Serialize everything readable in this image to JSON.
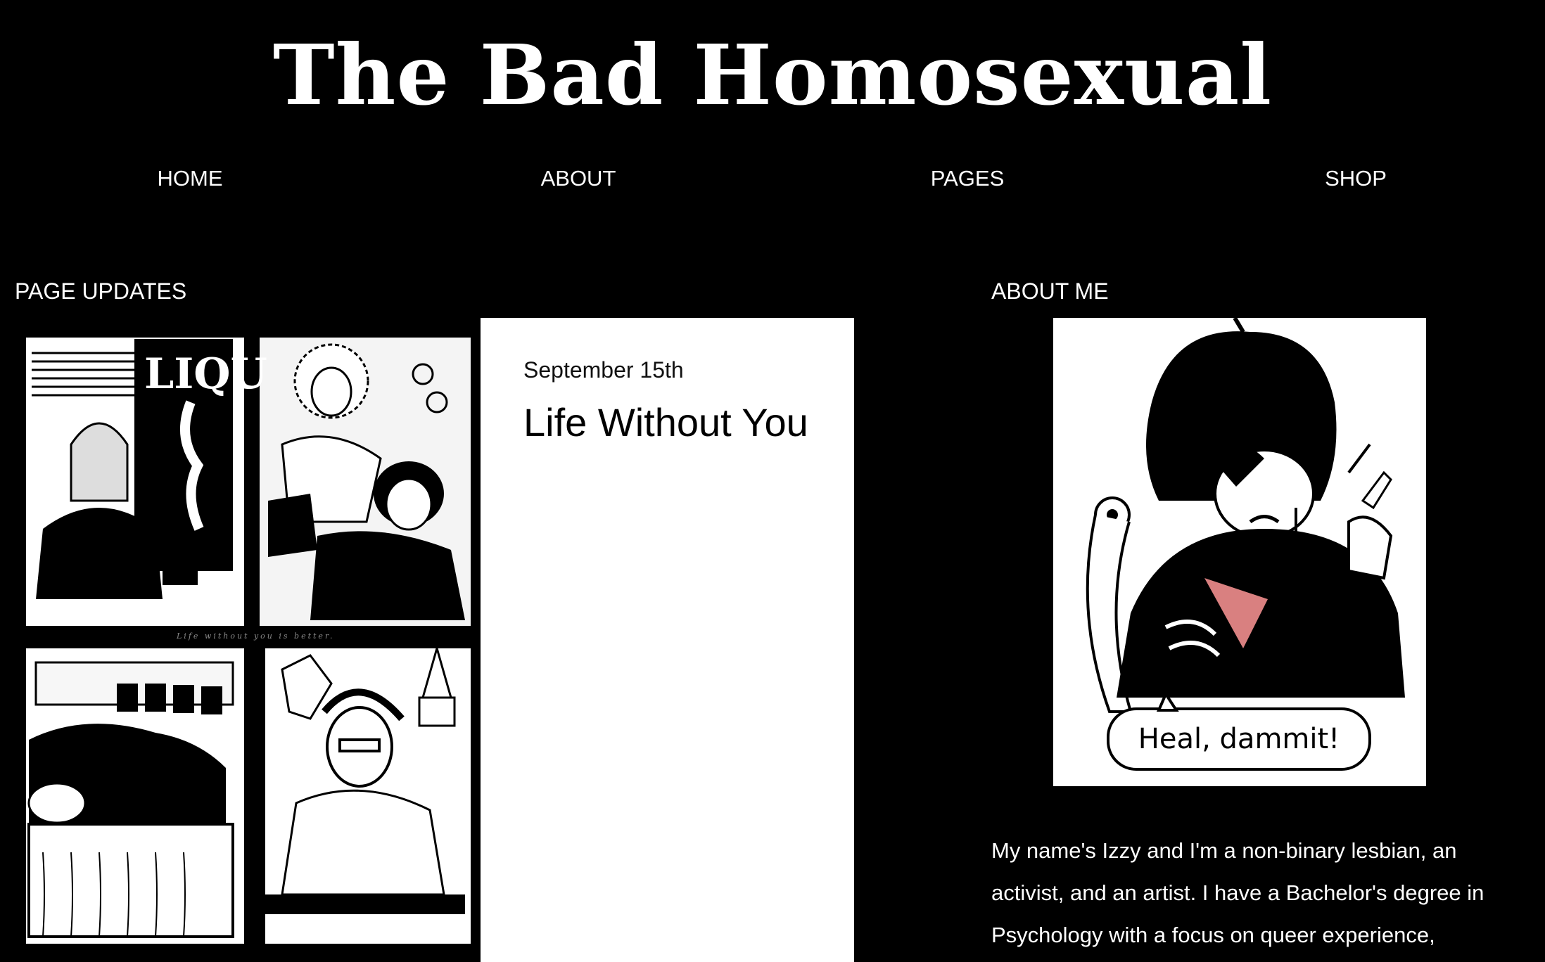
{
  "site": {
    "title": "The Bad Homosexual"
  },
  "nav": [
    {
      "label": "HOME"
    },
    {
      "label": "ABOUT"
    },
    {
      "label": "PAGES"
    },
    {
      "label": "SHOP"
    }
  ],
  "updates": {
    "heading": "PAGE UPDATES",
    "post": {
      "date": "September 15th",
      "title": "Life Without You",
      "image_caption": "Life without you is better.",
      "image_sign": "LIQU"
    }
  },
  "about": {
    "heading": "ABOUT ME",
    "speech_bubble": "Heal, dammit!",
    "bio": "My name's Izzy and I'm a non-binary lesbian, an activist, and an artist. I have a Bachelor's degree in Psychology with a focus on queer experience,"
  }
}
